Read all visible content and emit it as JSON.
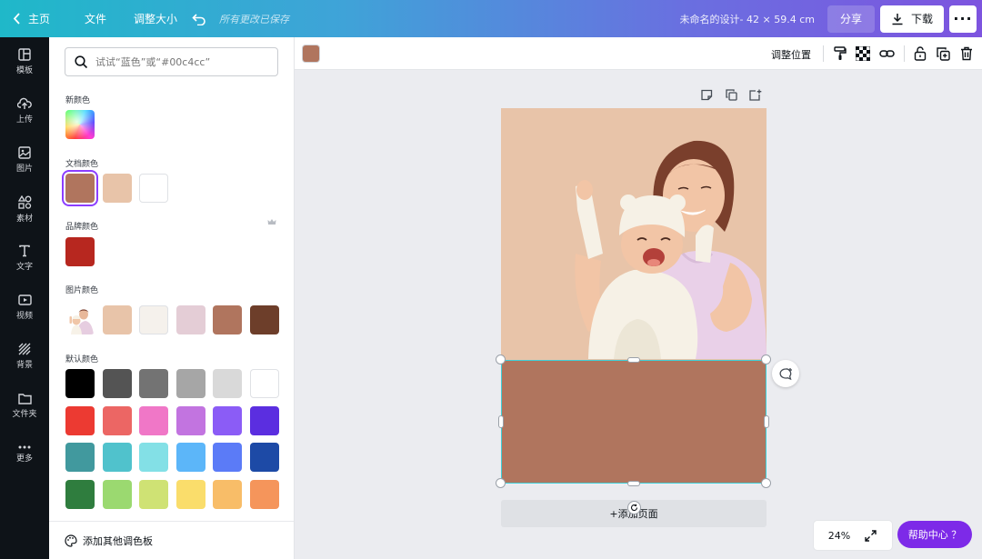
{
  "topbar": {
    "home_label": "主页",
    "file_label": "文件",
    "resize_label": "调整大小",
    "saved_status": "所有更改已保存",
    "doc_title": "未命名的设计- 42 × 59.4 cm",
    "share_label": "分享",
    "download_label": "下载"
  },
  "rail": {
    "items": [
      {
        "label": "模板",
        "icon": "template-icon"
      },
      {
        "label": "上传",
        "icon": "upload-icon"
      },
      {
        "label": "图片",
        "icon": "photo-icon"
      },
      {
        "label": "素材",
        "icon": "elements-icon"
      },
      {
        "label": "文字",
        "icon": "text-icon"
      },
      {
        "label": "视频",
        "icon": "video-icon"
      },
      {
        "label": "背景",
        "icon": "background-icon"
      },
      {
        "label": "文件夹",
        "icon": "folder-icon"
      },
      {
        "label": "更多",
        "icon": "more-icon"
      }
    ]
  },
  "panel": {
    "search_placeholder": "试试“蓝色”或“#00c4cc”",
    "new_color_label": "新颜色",
    "doc_colors_label": "文档颜色",
    "doc_colors": [
      "#b0755e",
      "#e8c4a9",
      "#ffffff"
    ],
    "brand_colors_label": "品牌颜色",
    "brand_colors": [
      "#b7271f"
    ],
    "image_colors_label": "图片颜色",
    "image_colors": [
      "#e8c4a9",
      "#f5f1ec",
      "#e4cdd6",
      "#b0755e",
      "#6d3e2a"
    ],
    "default_colors_label": "默认颜色",
    "default_colors": [
      [
        "#000000",
        "#545454",
        "#737373",
        "#a6a6a6",
        "#d9d9d9",
        "#ffffff"
      ],
      [
        "#ec3a32",
        "#ec6664",
        "#f077c7",
        "#c274e0",
        "#8b5cf6",
        "#5b2ee0"
      ],
      [
        "#41999e",
        "#50c2cc",
        "#83e0e6",
        "#5cb6f9",
        "#5b7bf7",
        "#1d4aa6"
      ],
      [
        "#2f7d3e",
        "#9bd970",
        "#cfe274",
        "#fadd6b",
        "#f8bd68",
        "#f5955b"
      ]
    ],
    "add_palette_label": "添加其他调色板"
  },
  "context": {
    "selected_color": "#b0755e",
    "position_label": "调整位置"
  },
  "canvas": {
    "add_page_label": "+添加页面",
    "zoom": "24%",
    "help_label": "帮助中心 ？"
  }
}
